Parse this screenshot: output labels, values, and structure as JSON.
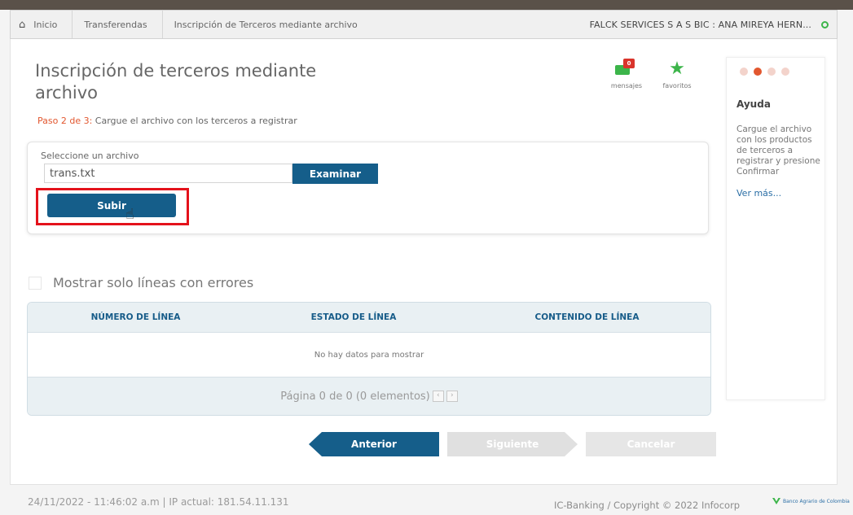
{
  "breadcrumb": {
    "home": "Inicio",
    "items": [
      "Transferendas",
      "Inscripción de Terceros mediante archivo"
    ],
    "company": "FALCK SERVICES S A S BIC : ANA MIREYA HERN..."
  },
  "page": {
    "title": "Inscripción de terceros mediante archivo",
    "step_prefix": "Paso 2 de 3:",
    "step_text": "Cargue el archivo con los terceros a registrar"
  },
  "quick_actions": {
    "messages_label": "mensajes",
    "messages_count": "0",
    "favorites_label": "favoritos"
  },
  "help": {
    "title": "Ayuda",
    "text": "Cargue el archivo con los productos de terceros a registrar y presione Confirmar",
    "more": "Ver más..."
  },
  "upload": {
    "label": "Seleccione un archivo",
    "file_value": "trans.txt",
    "browse_label": "Examinar",
    "upload_label": "Subir"
  },
  "filter": {
    "label": "Mostrar solo líneas con errores"
  },
  "table": {
    "columns": [
      "NÚMERO DE LÍNEA",
      "ESTADO DE LÍNEA",
      "CONTENIDO DE LÍNEA"
    ],
    "empty": "No hay datos para mostrar",
    "pager": "Página 0 de 0 (0 elementos)"
  },
  "nav": {
    "prev": "Anterior",
    "next": "Siguiente",
    "cancel": "Cancelar"
  },
  "footer": {
    "left": "24/11/2022 - 11:46:02 a.m | IP actual: 181.54.11.131",
    "right": "IC-Banking / Copyright © 2022 Infocorp",
    "logo": "Banco Agrario de Colombia"
  }
}
